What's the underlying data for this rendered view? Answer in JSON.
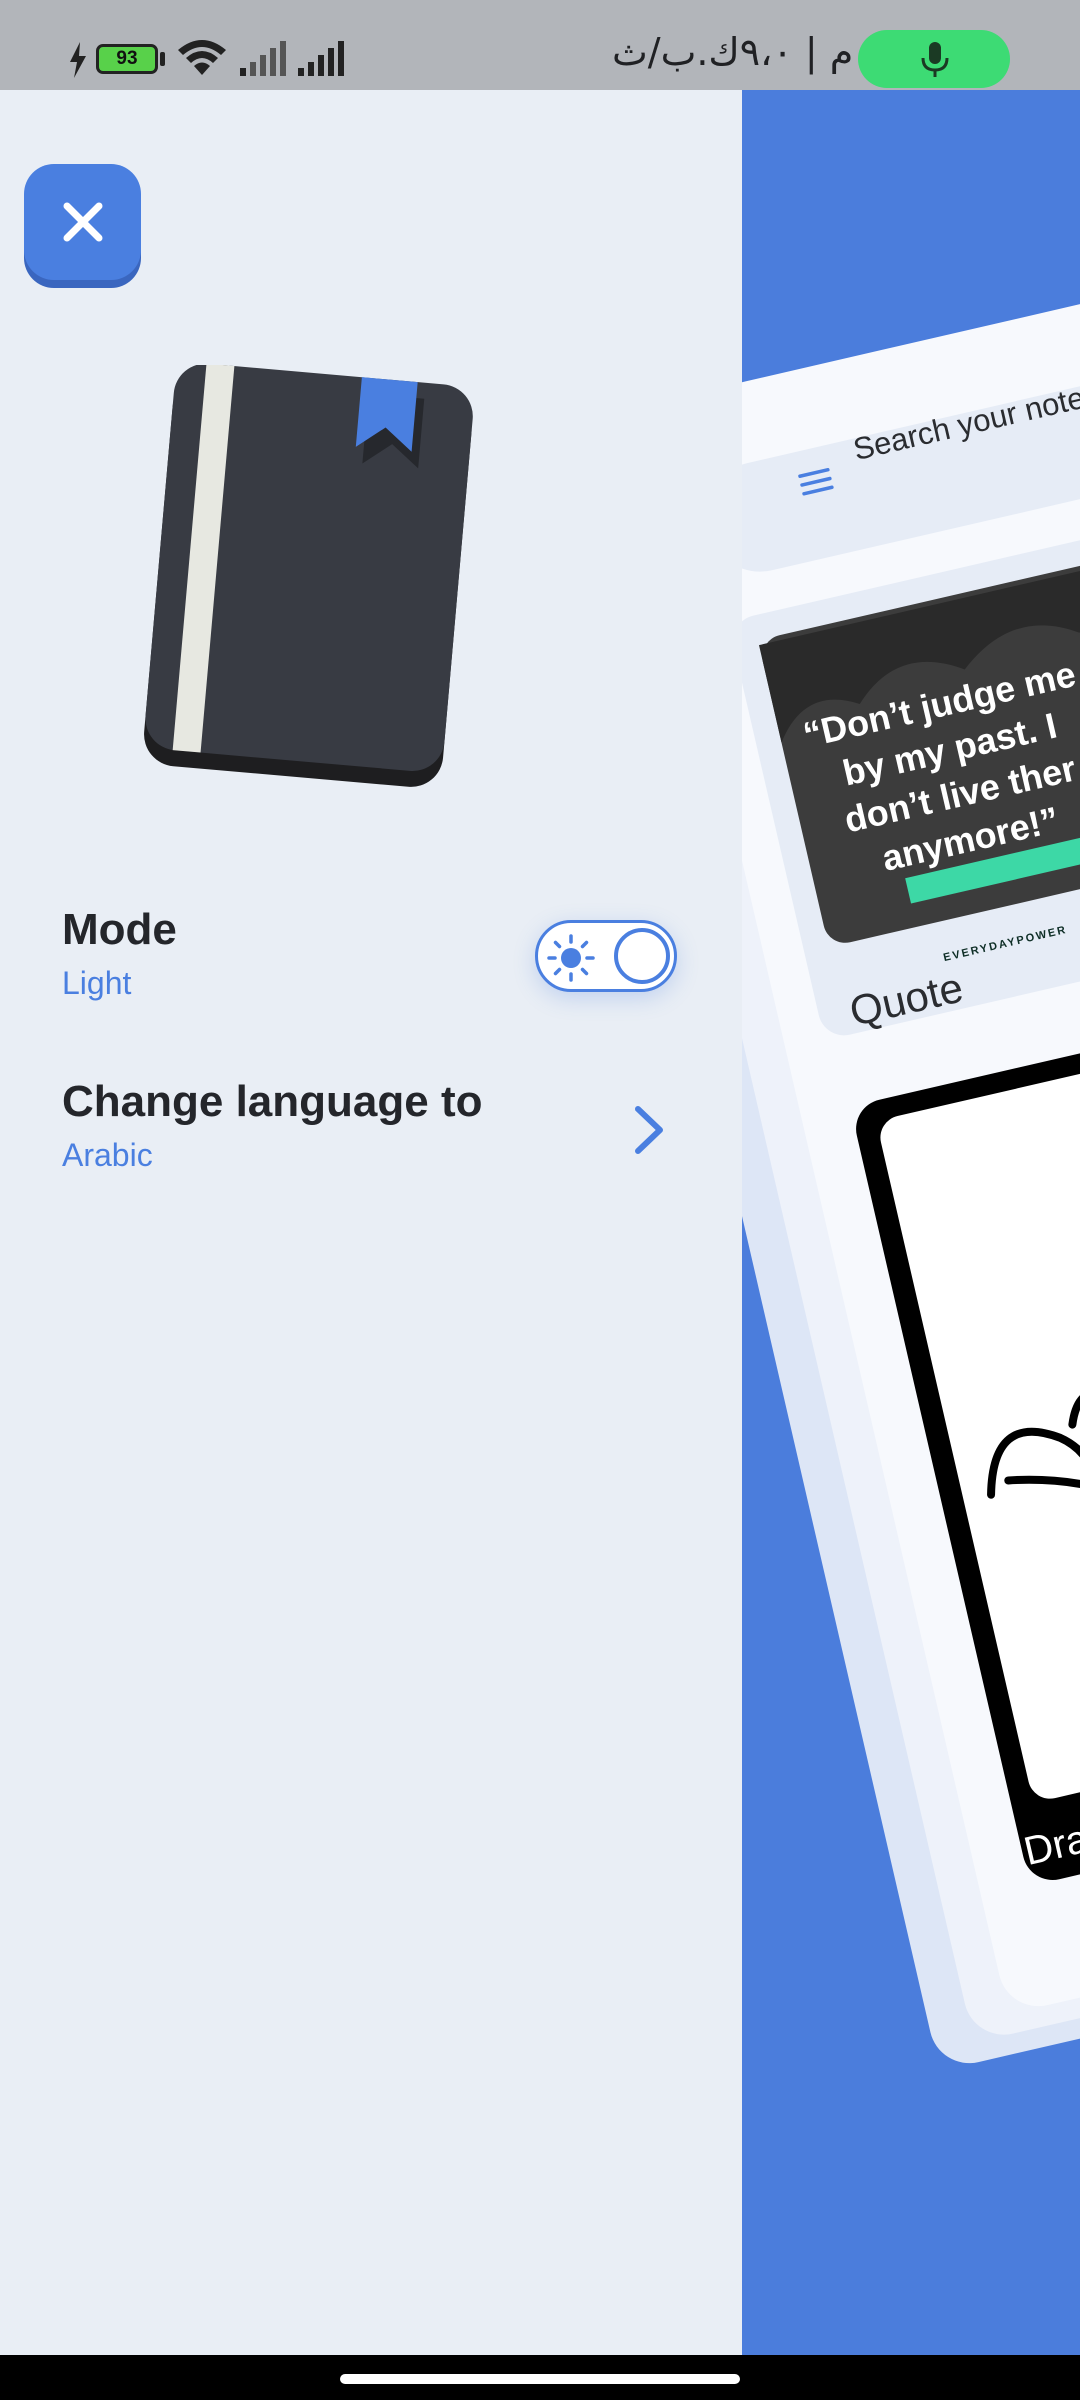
{
  "status_bar": {
    "battery_level": "93",
    "time_text": "٢:١٨ م | ٩،٠ك.ب/ث",
    "icons": [
      "charging-icon",
      "battery-icon",
      "wifi-icon",
      "signal-icon",
      "signal-icon",
      "mic-icon"
    ],
    "mic_pill_color": "#3DDB74"
  },
  "settings": {
    "mode": {
      "title": "Mode",
      "value": "Light",
      "toggle_state": "light"
    },
    "language": {
      "title": "Change language to",
      "value": "Arabic"
    }
  },
  "preview": {
    "search_placeholder": "Search your note",
    "quote_card": {
      "image_text_lines": [
        "“Don’t judge me",
        "by my past. I",
        "don’t live ther",
        "anymore!”"
      ],
      "brand": "EVERYDAYPOWER",
      "label": "Quote"
    },
    "drawing_card": {
      "label": "Dra"
    }
  },
  "colors": {
    "accent": "#4A7FE0",
    "panel_bg": "#E9EEF5",
    "preview_bg": "#4B7DDC",
    "text_dark": "#24262B"
  }
}
